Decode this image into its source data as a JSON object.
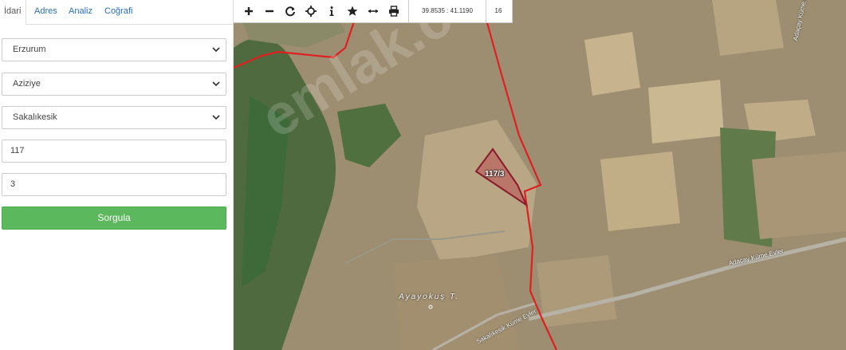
{
  "tabs": [
    "İdari",
    "Adres",
    "Analiz",
    "Coğrafi"
  ],
  "form": {
    "il": "Erzurum",
    "ilce": "Aziziye",
    "mahalle": "Sakalıkesik",
    "ada": "117",
    "parsel": "3",
    "submit": "Sorgula"
  },
  "toolbar": {
    "tools": [
      "zoom-in",
      "zoom-out",
      "refresh",
      "locate",
      "info",
      "favorite",
      "measure",
      "print"
    ],
    "coordinates": "39.8535 : 41.1190",
    "zoom_level": "16"
  },
  "map": {
    "parcel_label": "117/3",
    "place_label": "Ayayokuş T.",
    "road_label_1": "Adaçay Küme Evler",
    "road_label_2": "Sakalıkesik Küme Evler",
    "road_label_3": "Adaçay Küme Evler",
    "watermark": "emlak.com",
    "boundary_color": "#e02020",
    "parcel_color": "#8b1a2a"
  }
}
